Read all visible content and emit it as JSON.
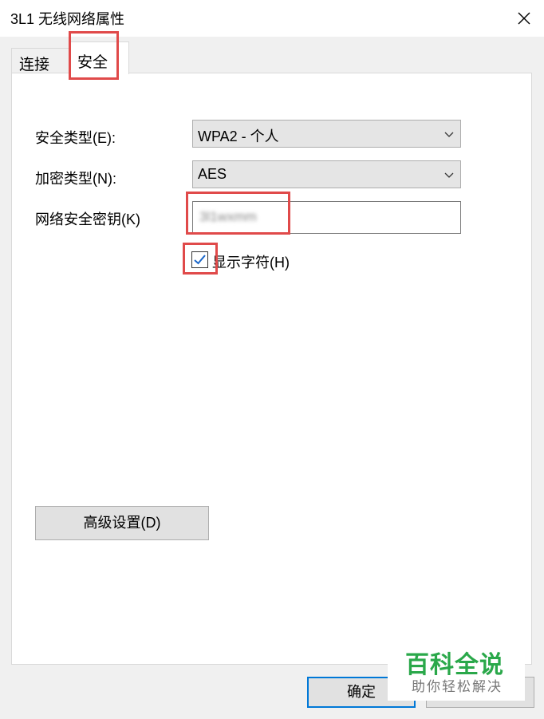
{
  "window": {
    "title": "3L1 无线网络属性"
  },
  "tabs": [
    {
      "label": "连接",
      "active": false
    },
    {
      "label": "安全",
      "active": true
    }
  ],
  "security": {
    "type_label": "安全类型(E):",
    "type_value": "WPA2 - 个人",
    "encryption_label": "加密类型(N):",
    "encryption_value": "AES",
    "key_label": "网络安全密钥(K)",
    "key_value": "3l1wxmm",
    "show_chars_label": "显示字符(H)",
    "show_chars_checked": true
  },
  "buttons": {
    "advanced": "高级设置(D)",
    "ok": "确定"
  },
  "watermark": {
    "main": "百科全说",
    "sub": "助你轻松解决"
  },
  "colors": {
    "highlight": "#e04a4a",
    "accent": "#0078d7",
    "watermark_green": "#2aa84a"
  }
}
